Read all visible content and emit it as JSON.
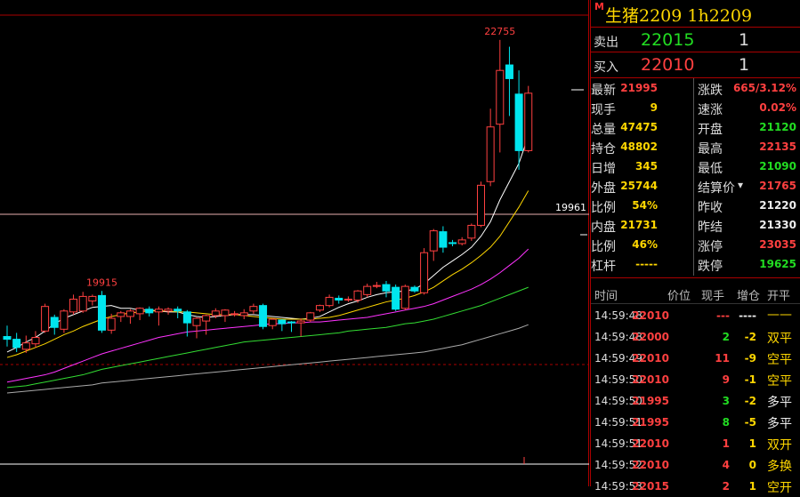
{
  "instrument": {
    "marker": "M",
    "title": "生猪2209  1h2209"
  },
  "orderbook": {
    "ask": {
      "label": "卖出",
      "price": "22015",
      "qty": "1"
    },
    "bid": {
      "label": "买入",
      "price": "22010",
      "qty": "1"
    }
  },
  "stats_left": [
    {
      "label": "最新",
      "value": "21995",
      "color": "red"
    },
    {
      "label": "现手",
      "value": "9",
      "color": "yellow"
    },
    {
      "label": "总量",
      "value": "47475",
      "color": "yellow"
    },
    {
      "label": "持仓",
      "value": "48802",
      "color": "yellow"
    },
    {
      "label": "日增",
      "value": "345",
      "color": "yellow"
    },
    {
      "label": "外盘",
      "value": "25744",
      "color": "yellow"
    },
    {
      "label": "比例",
      "value": "54%",
      "color": "yellow"
    },
    {
      "label": "内盘",
      "value": "21731",
      "color": "yellow"
    },
    {
      "label": "比例",
      "value": "46%",
      "color": "yellow"
    },
    {
      "label": "杠杆",
      "value": "-----",
      "color": "yellow"
    }
  ],
  "stats_right": [
    {
      "label": "涨跌",
      "value": "665/3.12%",
      "color": "red"
    },
    {
      "label": "速涨",
      "value": "0.02%",
      "color": "red"
    },
    {
      "label": "开盘",
      "value": "21120",
      "color": "green"
    },
    {
      "label": "最高",
      "value": "22135",
      "color": "red"
    },
    {
      "label": "最低",
      "value": "21090",
      "color": "green"
    },
    {
      "label": "结算价",
      "value": "21765",
      "color": "red"
    },
    {
      "label": "昨收",
      "value": "21220",
      "color": "white"
    },
    {
      "label": "昨结",
      "value": "21330",
      "color": "white"
    },
    {
      "label": "涨停",
      "value": "23035",
      "color": "red"
    },
    {
      "label": "跌停",
      "value": "19625",
      "color": "green"
    }
  ],
  "ticks_header": [
    "时间",
    "价位",
    "现手",
    "增仓",
    "开平"
  ],
  "ticks": [
    {
      "time": "14:59:48",
      "price": "22010",
      "vol": "---",
      "vol_color": "red",
      "chg": "----",
      "chg_color": "white",
      "type": "——",
      "type_color": "yellow"
    },
    {
      "time": "14:59:48",
      "price": "22000",
      "vol": "2",
      "vol_color": "green",
      "chg": "-2",
      "chg_color": "yellow",
      "type": "双平",
      "type_color": "yellow"
    },
    {
      "time": "14:59:49",
      "price": "22010",
      "vol": "11",
      "vol_color": "red",
      "chg": "-9",
      "chg_color": "yellow",
      "type": "空平",
      "type_color": "yellow"
    },
    {
      "time": "14:59:50",
      "price": "22010",
      "vol": "9",
      "vol_color": "red",
      "chg": "-1",
      "chg_color": "yellow",
      "type": "空平",
      "type_color": "yellow"
    },
    {
      "time": "14:59:50",
      "price": "21995",
      "vol": "3",
      "vol_color": "green",
      "chg": "-2",
      "chg_color": "yellow",
      "type": "多平",
      "type_color": "white"
    },
    {
      "time": "14:59:51",
      "price": "21995",
      "vol": "8",
      "vol_color": "green",
      "chg": "-5",
      "chg_color": "yellow",
      "type": "多平",
      "type_color": "white"
    },
    {
      "time": "14:59:51",
      "price": "22010",
      "vol": "1",
      "vol_color": "red",
      "chg": "1",
      "chg_color": "yellow",
      "type": "双开",
      "type_color": "yellow"
    },
    {
      "time": "14:59:52",
      "price": "22010",
      "vol": "4",
      "vol_color": "red",
      "chg": "0",
      "chg_color": "yellow",
      "type": "多换",
      "type_color": "yellow"
    },
    {
      "time": "14:59:53",
      "price": "22015",
      "vol": "2",
      "vol_color": "red",
      "chg": "1",
      "chg_color": "yellow",
      "type": "空开",
      "type_color": "yellow"
    }
  ],
  "chart_data": {
    "type": "candlestick",
    "period": "1h",
    "high_label": "22755",
    "low_label": "19915",
    "ref_label": "19961",
    "ylim": [
      18900,
      22900
    ],
    "candles": [
      {
        "o": 19500,
        "c": 19470,
        "h": 19620,
        "l": 19390
      },
      {
        "o": 19470,
        "c": 19380,
        "h": 19540,
        "l": 19330
      },
      {
        "o": 19360,
        "c": 19430,
        "h": 19510,
        "l": 19320
      },
      {
        "o": 19420,
        "c": 19490,
        "h": 19560,
        "l": 19380
      },
      {
        "o": 19560,
        "c": 19830,
        "h": 19860,
        "l": 19540
      },
      {
        "o": 19710,
        "c": 19600,
        "h": 19740,
        "l": 19520
      },
      {
        "o": 19580,
        "c": 19780,
        "h": 19800,
        "l": 19540
      },
      {
        "o": 19770,
        "c": 19910,
        "h": 19960,
        "l": 19740
      },
      {
        "o": 19780,
        "c": 19940,
        "h": 19990,
        "l": 19760
      },
      {
        "o": 19890,
        "c": 19940,
        "h": 19960,
        "l": 19840
      },
      {
        "o": 19950,
        "c": 19570,
        "h": 20000,
        "l": 19540
      },
      {
        "o": 19570,
        "c": 19700,
        "h": 19750,
        "l": 19530
      },
      {
        "o": 19720,
        "c": 19760,
        "h": 19780,
        "l": 19660
      },
      {
        "o": 19720,
        "c": 19780,
        "h": 19800,
        "l": 19640
      },
      {
        "o": 19750,
        "c": 19810,
        "h": 19820,
        "l": 19680
      },
      {
        "o": 19800,
        "c": 19760,
        "h": 19830,
        "l": 19720
      },
      {
        "o": 19770,
        "c": 19800,
        "h": 19830,
        "l": 19620
      },
      {
        "o": 19780,
        "c": 19800,
        "h": 19820,
        "l": 19740
      },
      {
        "o": 19800,
        "c": 19780,
        "h": 19830,
        "l": 19700
      },
      {
        "o": 19770,
        "c": 19650,
        "h": 19790,
        "l": 19500
      },
      {
        "o": 19620,
        "c": 19700,
        "h": 19710,
        "l": 19480
      },
      {
        "o": 19670,
        "c": 19730,
        "h": 19740,
        "l": 19520
      },
      {
        "o": 19730,
        "c": 19780,
        "h": 19810,
        "l": 19700
      },
      {
        "o": 19730,
        "c": 19790,
        "h": 19800,
        "l": 19660
      },
      {
        "o": 19750,
        "c": 19750,
        "h": 19780,
        "l": 19720
      },
      {
        "o": 19730,
        "c": 19760,
        "h": 19800,
        "l": 19690
      },
      {
        "o": 19780,
        "c": 19830,
        "h": 19860,
        "l": 19750
      },
      {
        "o": 19840,
        "c": 19610,
        "h": 19860,
        "l": 19580
      },
      {
        "o": 19620,
        "c": 19690,
        "h": 19700,
        "l": 19580
      },
      {
        "o": 19680,
        "c": 19640,
        "h": 19690,
        "l": 19560
      },
      {
        "o": 19660,
        "c": 19650,
        "h": 19670,
        "l": 19550
      },
      {
        "o": 19650,
        "c": 19670,
        "h": 19700,
        "l": 19500
      },
      {
        "o": 19680,
        "c": 19760,
        "h": 19770,
        "l": 19660
      },
      {
        "o": 19790,
        "c": 19840,
        "h": 19850,
        "l": 19770
      },
      {
        "o": 19840,
        "c": 19930,
        "h": 19960,
        "l": 19820
      },
      {
        "o": 19920,
        "c": 19900,
        "h": 19950,
        "l": 19860
      },
      {
        "o": 19910,
        "c": 19910,
        "h": 19940,
        "l": 19880
      },
      {
        "o": 19900,
        "c": 20000,
        "h": 20010,
        "l": 19870
      },
      {
        "o": 19960,
        "c": 20050,
        "h": 20080,
        "l": 19930
      },
      {
        "o": 20050,
        "c": 20060,
        "h": 20100,
        "l": 20030
      },
      {
        "o": 20070,
        "c": 20000,
        "h": 20110,
        "l": 19930
      },
      {
        "o": 20040,
        "c": 19800,
        "h": 20070,
        "l": 19780
      },
      {
        "o": 19810,
        "c": 20050,
        "h": 20070,
        "l": 19790
      },
      {
        "o": 20040,
        "c": 20000,
        "h": 20060,
        "l": 19980
      },
      {
        "o": 19980,
        "c": 20420,
        "h": 20470,
        "l": 19960
      },
      {
        "o": 20440,
        "c": 20660,
        "h": 20680,
        "l": 20330
      },
      {
        "o": 20650,
        "c": 20480,
        "h": 20710,
        "l": 20420
      },
      {
        "o": 20530,
        "c": 20520,
        "h": 20560,
        "l": 20490
      },
      {
        "o": 20520,
        "c": 20560,
        "h": 20590,
        "l": 20500
      },
      {
        "o": 20580,
        "c": 20720,
        "h": 20740,
        "l": 20550
      },
      {
        "o": 20720,
        "c": 21160,
        "h": 21200,
        "l": 20700
      },
      {
        "o": 21200,
        "c": 21800,
        "h": 22000,
        "l": 21150
      },
      {
        "o": 21830,
        "c": 22420,
        "h": 22755,
        "l": 21520
      },
      {
        "o": 22480,
        "c": 22330,
        "h": 22680,
        "l": 21920
      },
      {
        "o": 22160,
        "c": 21540,
        "h": 22420,
        "l": 21330
      },
      {
        "o": 21540,
        "c": 22170,
        "h": 22250,
        "l": 21520
      }
    ],
    "ma_lines": [
      {
        "color": "#ffffff",
        "values": [
          19330,
          19380,
          19440,
          19490,
          19560,
          19640,
          19700,
          19740,
          19780,
          19820,
          19830,
          19840,
          19810,
          19810,
          19790,
          19790,
          19780,
          19770,
          19770,
          19740,
          19720,
          19710,
          19720,
          19730,
          19740,
          19740,
          19740,
          19730,
          19720,
          19710,
          19700,
          19690,
          19700,
          19720,
          19770,
          19820,
          19860,
          19890,
          19930,
          19960,
          19980,
          19990,
          20000,
          20020,
          20080,
          20170,
          20260,
          20330,
          20400,
          20480,
          20600,
          20760,
          21000,
          21200,
          21400,
          21700
        ]
      },
      {
        "color": "#ffd700",
        "values": [
          19270,
          19300,
          19340,
          19380,
          19420,
          19470,
          19520,
          19560,
          19610,
          19650,
          19690,
          19720,
          19740,
          19760,
          19770,
          19780,
          19780,
          19780,
          19770,
          19770,
          19760,
          19750,
          19740,
          19740,
          19740,
          19730,
          19720,
          19710,
          19700,
          19690,
          19690,
          19690,
          19690,
          19700,
          19710,
          19730,
          19760,
          19790,
          19820,
          19850,
          19880,
          19900,
          19920,
          19950,
          19990,
          20040,
          20110,
          20180,
          20240,
          20310,
          20390,
          20480,
          20600,
          20760,
          20920,
          21100
        ]
      },
      {
        "color": "#ff33ff",
        "values": [
          19000,
          19020,
          19040,
          19060,
          19080,
          19110,
          19150,
          19190,
          19230,
          19270,
          19310,
          19340,
          19370,
          19400,
          19430,
          19460,
          19490,
          19510,
          19530,
          19550,
          19560,
          19570,
          19580,
          19590,
          19600,
          19610,
          19620,
          19630,
          19640,
          19640,
          19650,
          19650,
          19660,
          19660,
          19670,
          19680,
          19690,
          19700,
          19710,
          19730,
          19750,
          19770,
          19790,
          19810,
          19830,
          19860,
          19900,
          19940,
          19980,
          20020,
          20070,
          20130,
          20200,
          20280,
          20360,
          20460
        ]
      },
      {
        "color": "#33dd33",
        "values": [
          18940,
          18950,
          18960,
          18980,
          19000,
          19020,
          19040,
          19060,
          19080,
          19110,
          19140,
          19160,
          19180,
          19200,
          19220,
          19240,
          19260,
          19280,
          19300,
          19320,
          19340,
          19360,
          19380,
          19400,
          19420,
          19440,
          19450,
          19460,
          19470,
          19480,
          19490,
          19500,
          19510,
          19520,
          19530,
          19540,
          19560,
          19570,
          19580,
          19590,
          19600,
          19620,
          19640,
          19650,
          19670,
          19690,
          19720,
          19750,
          19780,
          19810,
          19840,
          19880,
          19920,
          19960,
          20000,
          20040
        ]
      },
      {
        "color": "#aaaaaa",
        "values": [
          18880,
          18890,
          18900,
          18910,
          18920,
          18930,
          18940,
          18950,
          18960,
          18970,
          18990,
          19000,
          19010,
          19020,
          19030,
          19040,
          19050,
          19060,
          19070,
          19080,
          19090,
          19100,
          19110,
          19120,
          19130,
          19140,
          19150,
          19160,
          19170,
          19180,
          19190,
          19200,
          19210,
          19220,
          19230,
          19240,
          19250,
          19260,
          19270,
          19280,
          19290,
          19300,
          19310,
          19320,
          19330,
          19350,
          19370,
          19390,
          19410,
          19440,
          19470,
          19500,
          19530,
          19560,
          19590,
          19630
        ]
      }
    ]
  }
}
